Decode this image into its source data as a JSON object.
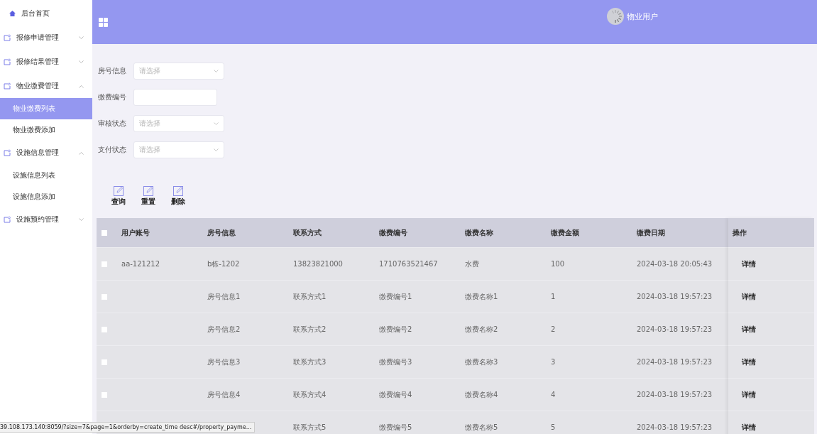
{
  "sidebar": {
    "items": [
      {
        "kind": "home",
        "label": "后台首页",
        "selected": false
      },
      {
        "kind": "group",
        "label": "报修申请管理",
        "expanded": false
      },
      {
        "kind": "group",
        "label": "报修结果管理",
        "expanded": false
      },
      {
        "kind": "group",
        "label": "物业缴费管理",
        "expanded": true,
        "children": [
          {
            "label": "物业缴费列表",
            "selected": true
          },
          {
            "label": "物业缴费添加",
            "selected": false
          }
        ]
      },
      {
        "kind": "group",
        "label": "设施信息管理",
        "expanded": true,
        "children": [
          {
            "label": "设施信息列表",
            "selected": false
          },
          {
            "label": "设施信息添加",
            "selected": false
          }
        ]
      },
      {
        "kind": "group",
        "label": "设施预约管理",
        "expanded": false
      }
    ]
  },
  "header": {
    "user": "物业用户"
  },
  "filters": [
    {
      "kind": "select",
      "label": "房号信息",
      "placeholder": "请选择"
    },
    {
      "kind": "input",
      "label": "缴费编号"
    },
    {
      "kind": "select",
      "label": "审核状态",
      "placeholder": "请选择"
    },
    {
      "kind": "select",
      "label": "支付状态",
      "placeholder": "请选择"
    }
  ],
  "actions": [
    "查询",
    "重置",
    "删除"
  ],
  "table": {
    "columns": [
      "用户账号",
      "房号信息",
      "联系方式",
      "缴费编号",
      "缴费名称",
      "缴费金额",
      "缴费日期"
    ],
    "action_column": "操作",
    "all_checked": false,
    "rows": [
      {
        "checked": false,
        "cells": [
          "aa-121212",
          "b栋-1202",
          "13823821000",
          "1710763521467",
          "水费",
          "100",
          "2024-03-18 20:05:43"
        ],
        "action": "详情"
      },
      {
        "checked": false,
        "cells": [
          "",
          "房号信息1",
          "联系方式1",
          "缴费编号1",
          "缴费名称1",
          "1",
          "2024-03-18 19:57:23"
        ],
        "action": "详情"
      },
      {
        "checked": false,
        "cells": [
          "",
          "房号信息2",
          "联系方式2",
          "缴费编号2",
          "缴费名称2",
          "2",
          "2024-03-18 19:57:23"
        ],
        "action": "详情"
      },
      {
        "checked": false,
        "cells": [
          "",
          "房号信息3",
          "联系方式3",
          "缴费编号3",
          "缴费名称3",
          "3",
          "2024-03-18 19:57:23"
        ],
        "action": "详情"
      },
      {
        "checked": false,
        "cells": [
          "",
          "房号信息4",
          "联系方式4",
          "缴费编号4",
          "缴费名称4",
          "4",
          "2024-03-18 19:57:23"
        ],
        "action": "详情"
      },
      {
        "cells": [
          "",
          "",
          "联系方式5",
          "缴费编号5",
          "缴费名称5",
          "5",
          "2024-03-18 19:57:23"
        ],
        "action": "详情"
      }
    ]
  },
  "status_bar": {
    "url": "39.108.173.140:8059/?size=7&page=1&orderby=create_time desc#/property_payme..."
  }
}
